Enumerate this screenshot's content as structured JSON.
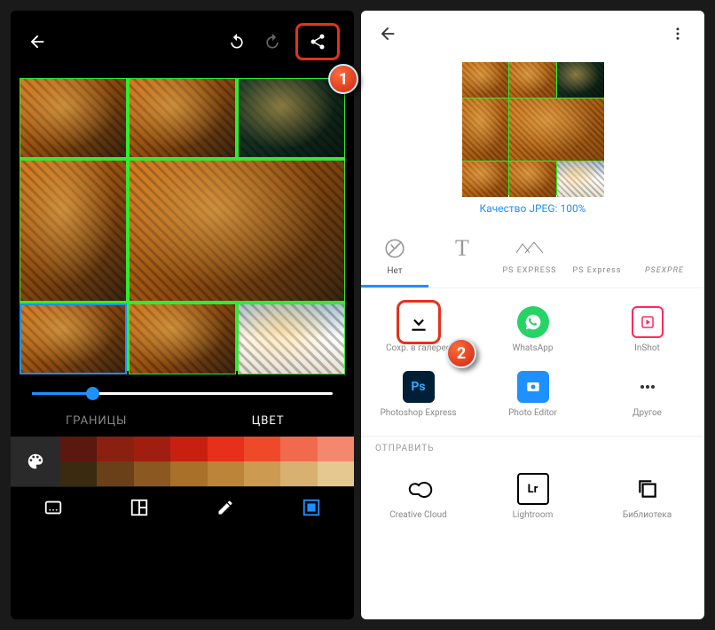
{
  "left": {
    "tabs": {
      "borders": "ГРАНИЦЫ",
      "color": "ЦВЕТ"
    },
    "palette": {
      "row1": [
        "#5a1810",
        "#8a2010",
        "#a01e10",
        "#c82010",
        "#e6301a",
        "#ee4a2a",
        "#f26a4e",
        "#f4886e"
      ],
      "row2": [
        "#3a2a10",
        "#6a4018",
        "#8a5820",
        "#a87028",
        "#bc8438",
        "#cc9a50",
        "#d8b070",
        "#e4c890"
      ]
    }
  },
  "right": {
    "quality_label": "Качество JPEG:",
    "quality_value": "100%",
    "watermarks": {
      "none": "Нет",
      "ps1": "PS EXPRESS",
      "ps2": "PS Express",
      "ps3": "PSEXPRE"
    },
    "apps": {
      "save": "Сохр. в галерее",
      "whatsapp": "WhatsApp",
      "inshot": "InShot",
      "psx": "Photoshop Express",
      "photoeditor": "Photo Editor",
      "other": "Другое"
    },
    "send_label": "ОТПРАВИТЬ",
    "send": {
      "cc": "Creative Cloud",
      "lr": "Lightroom",
      "lib": "Библиотека"
    }
  },
  "badges": {
    "one": "1",
    "two": "2"
  }
}
